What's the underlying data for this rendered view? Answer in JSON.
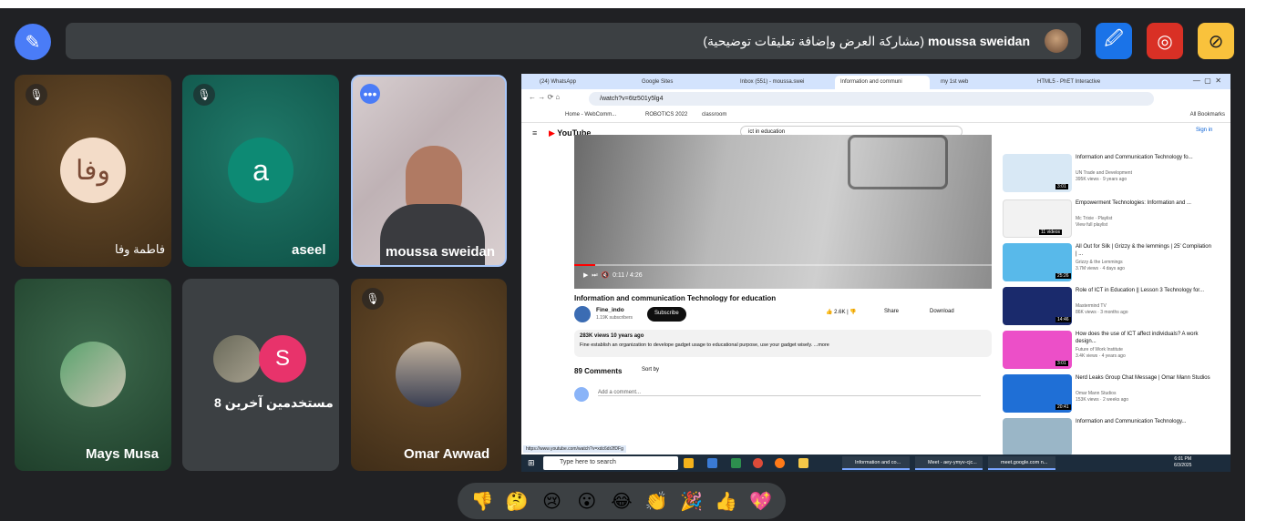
{
  "topbar": {
    "presenter_name": "moussa sweidan",
    "presenting_text": "(مشاركة العرض وإضافة تعليقات توضيحية)"
  },
  "participants": [
    {
      "name": "فاطمة وفا",
      "avatar_text": "وفا",
      "muted": true
    },
    {
      "name": "aseel",
      "avatar_text": "a",
      "muted": true
    },
    {
      "name": "moussa sweidan",
      "muted": false
    },
    {
      "name": "Mays Musa",
      "muted": false
    },
    {
      "name": "8 مستخدمين آخرين",
      "avatar_text": "S"
    },
    {
      "name": "Omar Awwad",
      "muted": true
    }
  ],
  "browser": {
    "tabs": [
      "(24) WhatsApp",
      "Google Sites",
      "Inbox (551) - moussa.swei",
      "Information and communi",
      "my 1st web",
      "HTML5 - PhET Interactive"
    ],
    "url": "/watch?v=6tz501y5lg4",
    "bookmarks": [
      "Home - WebComm...",
      "ROBOTICS 2022",
      "classroom"
    ],
    "all_bookmarks": "All Bookmarks"
  },
  "youtube": {
    "logo": "YouTube",
    "search_value": "ict in education",
    "sign_in": "Sign in",
    "video_time": "0:11 / 4:26",
    "video_title": "Information and communication Technology for education",
    "channel": "Fine_indo",
    "subscribers": "1.19K subscribers",
    "subscribe": "Subscribe",
    "likes": "2.6K",
    "share": "Share",
    "download": "Download",
    "views_line": "283K views  10 years ago",
    "description": "Fine establish an organization to develope gadget usage to educational purpose, use your gadget wisely. ...more",
    "comments_count": "89 Comments",
    "sort_by": "Sort by",
    "add_comment": "Add a comment...",
    "status_link": "https://www.youtube.com/watch?v=xdc6dr2fDFg",
    "suggestions": [
      {
        "title": "Information and Communication Technology fo...",
        "channel": "UN Trade and Development",
        "meta": "395K views · 9 years ago",
        "duration": "3:01",
        "color": "#d8e8f5"
      },
      {
        "title": "Empowerment Technologies: Information and ...",
        "channel": "Mc Trixie · Playlist",
        "meta": "View full playlist",
        "duration": "11 videos",
        "color": "#f2f2f2"
      },
      {
        "title": "All Out for Silk | Grizzy & the lemmings | 25' Compilation | ...",
        "channel": "Grizzy & the Lemmings",
        "meta": "3.7M views · 4 days ago",
        "duration": "25:26",
        "color": "#58b9ea"
      },
      {
        "title": "Role of ICT in Education || Lesson 3 Technology for...",
        "channel": "Mastermind TV",
        "meta": "86K views · 3 months ago",
        "duration": "14:46",
        "color": "#1a2a6c"
      },
      {
        "title": "How does the use of ICT affect individuals? A work design...",
        "channel": "Future of Work Institute",
        "meta": "3.4K views · 4 years ago",
        "duration": "3:01",
        "color": "#ec4fc8"
      },
      {
        "title": "Nerd Leaks Group Chat Message | Omar Mann Studios",
        "channel": "Omar Mann Studios",
        "meta": "153K views · 2 weeks ago",
        "duration": "20:41",
        "color": "#1f6fd6"
      },
      {
        "title": "Information and Communication Technology...",
        "channel": "",
        "meta": "",
        "duration": "",
        "color": "#9ab6c7"
      }
    ]
  },
  "taskbar": {
    "search_placeholder": "Type here to search",
    "apps": [
      "Information and co...",
      "Meet - aey-ymyv-cjc...",
      "meet.google.com n..."
    ],
    "time": "6:01 PM",
    "date": "6/3/2025"
  },
  "reactions": [
    "👎",
    "🤔",
    "😢",
    "😮",
    "😂",
    "👏",
    "🎉",
    "👍",
    "💖"
  ]
}
